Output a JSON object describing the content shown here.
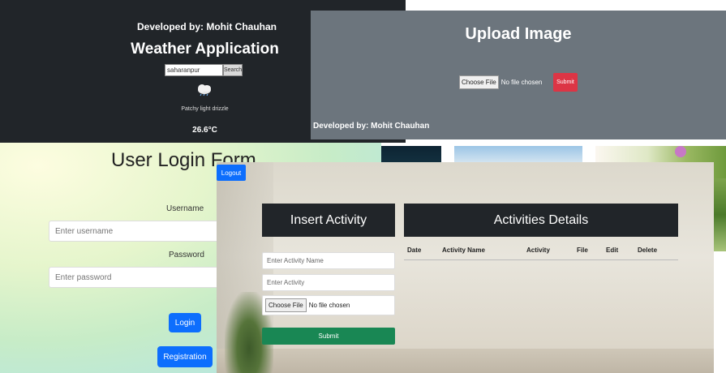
{
  "weather": {
    "developer": "Developed by: Mohit Chauhan",
    "title": "Weather Application",
    "search_value": "saharanpur",
    "search_button": "Search",
    "condition": "Patchy light drizzle",
    "temperature": "26.6°C",
    "icon": "cloud-drizzle-icon"
  },
  "upload": {
    "title": "Upload Image",
    "choose_file": "Choose File",
    "no_file": "No file chosen",
    "submit": "Submit",
    "developer": "Developed by: Mohit Chauhan"
  },
  "login": {
    "title": "User Login Form",
    "username_label": "Username",
    "username_placeholder": "Enter username",
    "password_label": "Password",
    "password_placeholder": "Enter password",
    "login_button": "Login",
    "register_button": "Registration"
  },
  "activity": {
    "logout": "Logout",
    "insert_header": "Insert Activity",
    "details_header": "Activities Details",
    "columns": [
      "Date",
      "Activity Name",
      "Activity",
      "File",
      "Edit",
      "Delete"
    ],
    "name_placeholder": "Enter Activity Name",
    "activity_placeholder": "Enter Activity",
    "choose_file": "Choose File",
    "no_file": "No file chosen",
    "submit": "Submit"
  },
  "colors": {
    "dark": "#212529",
    "gray": "#6c757d",
    "primary": "#0d6efd",
    "danger": "#dc3545",
    "success": "#198754"
  }
}
